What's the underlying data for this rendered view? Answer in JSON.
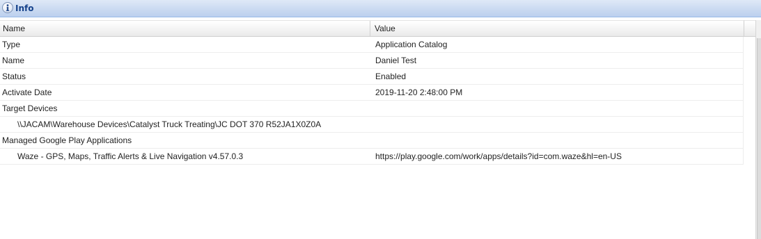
{
  "panel": {
    "title": "Info",
    "icon": "info-icon"
  },
  "grid": {
    "columns": [
      "Name",
      "Value"
    ],
    "rows": [
      {
        "name": "Type",
        "value": "Application Catalog",
        "indent": false
      },
      {
        "name": "Name",
        "value": "Daniel Test",
        "indent": false
      },
      {
        "name": "Status",
        "value": "Enabled",
        "indent": false
      },
      {
        "name": "Activate Date",
        "value": "2019-11-20 2:48:00 PM",
        "indent": false
      },
      {
        "name": "Target Devices",
        "value": "",
        "indent": false
      },
      {
        "name": "\\\\JACAM\\Warehouse Devices\\Catalyst Truck Treating\\JC DOT 370 R52JA1X0Z0A",
        "value": "",
        "indent": true
      },
      {
        "name": "Managed Google Play Applications",
        "value": "",
        "indent": false
      },
      {
        "name": "Waze - GPS, Maps, Traffic Alerts & Live Navigation v4.57.0.3",
        "value": "https://play.google.com/work/apps/details?id=com.waze&hl=en-US",
        "indent": true
      }
    ]
  },
  "colors": {
    "header_title": "#15428b",
    "header_border": "#99bbe8",
    "row_border": "#ededed"
  }
}
